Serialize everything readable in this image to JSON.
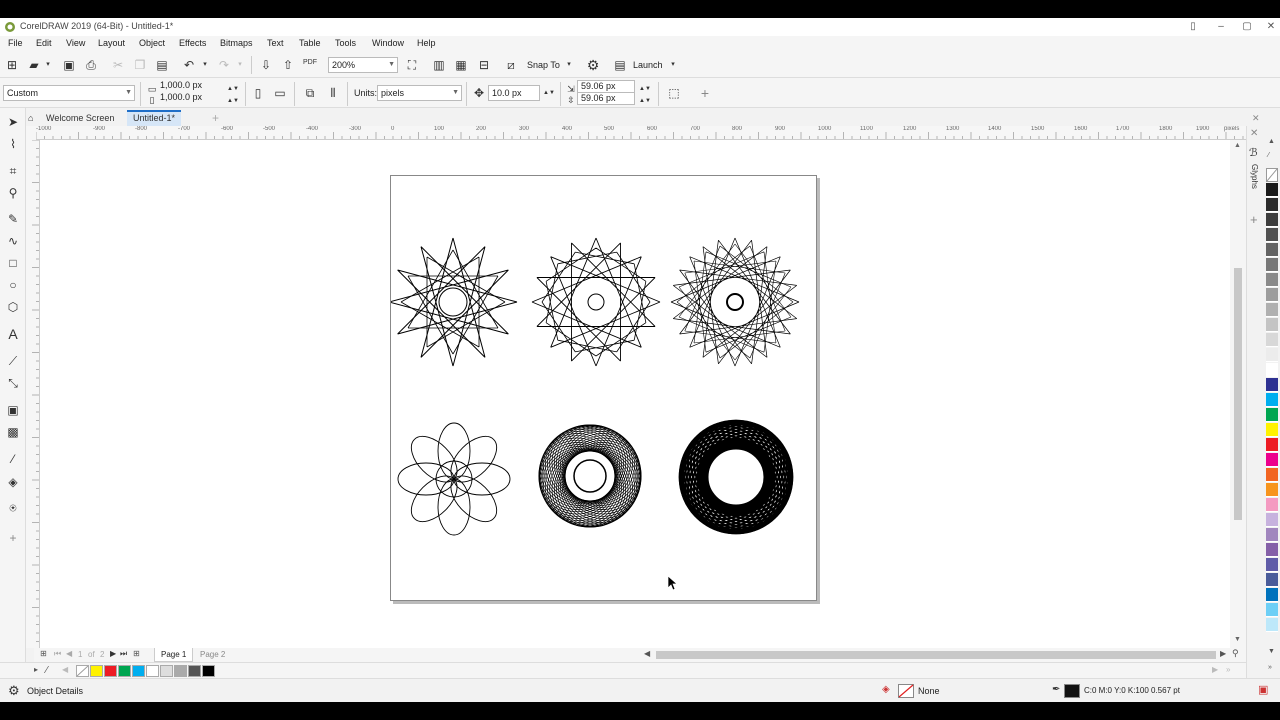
{
  "window": {
    "title": "CorelDRAW 2019 (64-Bit) - Untitled-1*"
  },
  "menu": [
    "File",
    "Edit",
    "View",
    "Layout",
    "Object",
    "Effects",
    "Bitmaps",
    "Text",
    "Table",
    "Tools",
    "Window",
    "Help"
  ],
  "toolbar": {
    "zoom_value": "200%",
    "snap_label": "Snap To",
    "launch_label": "Launch"
  },
  "property_bar": {
    "preset": "Custom",
    "width": "1,000.0 px",
    "height": "1,000.0 px",
    "units_label": "Units:",
    "units_value": "pixels",
    "nudge": "10.0 px",
    "dup_x": "59.06 px",
    "dup_y": "59.06 px"
  },
  "tabs": {
    "welcome": "Welcome Screen",
    "document": "Untitled-1*"
  },
  "ruler": {
    "units": "pixels",
    "h_labels": [
      "-1000",
      "-900",
      "-800",
      "-700",
      "-600",
      "-500",
      "-400",
      "-300",
      "-200",
      "-100",
      "0",
      "100",
      "200",
      "300",
      "400",
      "500",
      "600",
      "700",
      "800",
      "900",
      "1000",
      "1100",
      "1200",
      "1300",
      "1400",
      "1500",
      "1600",
      "1700",
      "1800",
      "1900"
    ],
    "v_labels": [
      "1200",
      "1100",
      "1000",
      "900",
      "800",
      "700",
      "600",
      "500",
      "400",
      "300",
      "200",
      "100",
      "0",
      "-100"
    ]
  },
  "docker": {
    "label": "Glyphs"
  },
  "page_nav": {
    "current": "1",
    "of_label": "of",
    "total": "2",
    "page1": "Page 1",
    "page2": "Page 2"
  },
  "status": {
    "object_details": "Object Details",
    "fill": "None",
    "outline": "C:0 M:0 Y:0 K:100  0.567 pt"
  },
  "colors": {
    "accent": "#1e6ec8",
    "palette": [
      "#ffffff",
      "#1a1a1a",
      "#2b2b2b",
      "#3d3d3d",
      "#505050",
      "#636363",
      "#777777",
      "#8a8a8a",
      "#9d9d9d",
      "#b0b0b0",
      "#c4c4c4",
      "#d8d8d8",
      "#ececec",
      "#ffffff",
      "#2e3192",
      "#00aeef",
      "#00a651",
      "#fff200",
      "#ed1c24",
      "#ec008c",
      "#f26522",
      "#f7941d",
      "#f49ac1",
      "#c7b2de",
      "#a186be",
      "#8560a8",
      "#605ca8",
      "#4a5c9a",
      "#0072bc",
      "#6dcff6",
      "#bde8fa"
    ],
    "doc_palette": [
      "#ffffff",
      "#fff200",
      "#ed1c24",
      "#00a651",
      "#00aeef",
      "#ffffff",
      "#dddddd",
      "#aaaaaa",
      "#555555",
      "#000000"
    ]
  }
}
